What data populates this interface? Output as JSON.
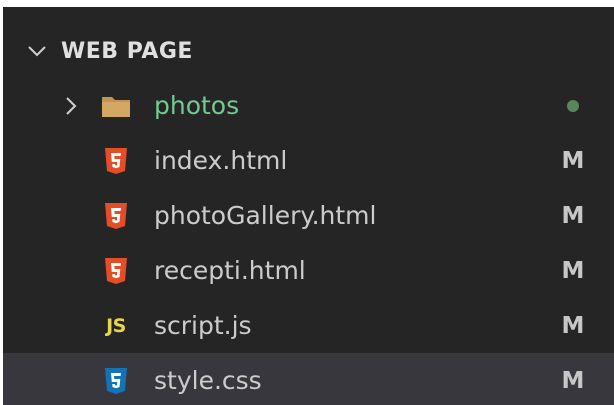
{
  "explorer": {
    "section_title": "WEB PAGE",
    "expanded": true,
    "items": [
      {
        "type": "folder",
        "label": "photos",
        "icon": "folder-icon",
        "expanded": false,
        "status": "",
        "status_indicator": "dot"
      },
      {
        "type": "file",
        "label": "index.html",
        "icon": "html5-icon",
        "status": "M"
      },
      {
        "type": "file",
        "label": "photoGallery.html",
        "icon": "html5-icon",
        "status": "M"
      },
      {
        "type": "file",
        "label": "recepti.html",
        "icon": "html5-icon",
        "status": "M"
      },
      {
        "type": "file",
        "label": "script.js",
        "icon": "js-icon",
        "icon_text": "JS",
        "status": "M"
      },
      {
        "type": "file",
        "label": "style.css",
        "icon": "css3-icon",
        "status": "M",
        "selected": true
      }
    ]
  },
  "colors": {
    "background": "#252526",
    "selected_row": "#37373d",
    "folder_label": "#73c991",
    "folder_dot": "#59865d",
    "html_icon": "#e44d26",
    "css_icon": "#1572b6",
    "js_icon": "#e8d44d"
  }
}
